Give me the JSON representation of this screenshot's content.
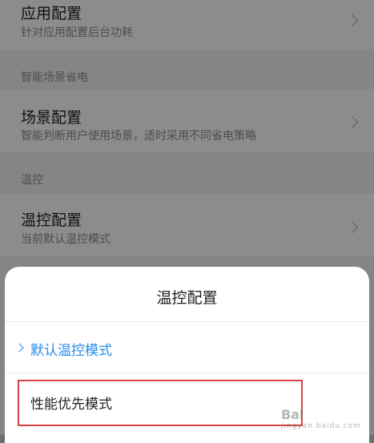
{
  "settings": {
    "app_config": {
      "title": "应用配置",
      "subtitle": "针对应用配置后台功耗"
    },
    "section_smart": "智能场景省电",
    "scene_config": {
      "title": "场景配置",
      "subtitle": "智能判断用户使用场景，适时采用不同省电策略"
    },
    "section_temp": "温控",
    "temp_config": {
      "title": "温控配置",
      "subtitle": "当前默认温控模式"
    }
  },
  "sheet": {
    "title": "温控配置",
    "options": [
      {
        "label": "默认温控模式",
        "selected": true
      },
      {
        "label": "性能优先模式",
        "selected": false
      }
    ]
  },
  "watermark": {
    "text": "Bai",
    "subtext": "jingyan.baidu.com"
  },
  "colors": {
    "accent": "#2a8ce6",
    "highlight": "#d94040"
  }
}
